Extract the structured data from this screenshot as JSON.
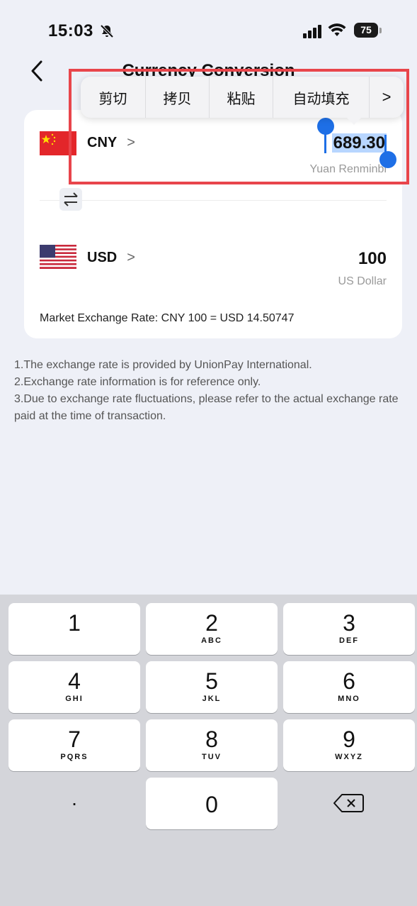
{
  "status_bar": {
    "time": "15:03",
    "battery": "75",
    "icons": [
      "bell-slash-icon",
      "signal-icon",
      "wifi-icon",
      "battery-icon"
    ]
  },
  "nav": {
    "title": "Currency Conversion",
    "back_icon": "chevron-left-icon"
  },
  "context_menu": {
    "items": [
      "剪切",
      "拷贝",
      "粘贴",
      "自动填充",
      ">"
    ]
  },
  "converter": {
    "from": {
      "code": "CNY",
      "chevron": ">",
      "amount": "689.30",
      "name": "Yuan Renminbi",
      "flag_icon": "china-flag-icon"
    },
    "to": {
      "code": "USD",
      "chevron": ">",
      "amount": "100",
      "name": "US Dollar",
      "flag_icon": "usa-flag-icon"
    },
    "swap_icon": "swap-arrows-icon",
    "rate_text": "Market Exchange Rate:  CNY 100 = USD 14.50747"
  },
  "notes": [
    "1.The exchange rate is provided by UnionPay International.",
    "2.Exchange rate information is for reference only.",
    "3.Due to exchange rate fluctuations, please refer to the actual exchange rate paid at the time of transaction."
  ],
  "keypad": {
    "keys": [
      {
        "num": "1",
        "letters": ""
      },
      {
        "num": "2",
        "letters": "ABC"
      },
      {
        "num": "3",
        "letters": "DEF"
      },
      {
        "num": "4",
        "letters": "GHI"
      },
      {
        "num": "5",
        "letters": "JKL"
      },
      {
        "num": "6",
        "letters": "MNO"
      },
      {
        "num": "7",
        "letters": "PQRS"
      },
      {
        "num": "8",
        "letters": "TUV"
      },
      {
        "num": "9",
        "letters": "WXYZ"
      }
    ],
    "decimal": ".",
    "zero": "0",
    "delete_icon": "backspace-icon"
  },
  "colors": {
    "accent": "#1e6fe6",
    "highlight_box": "#e8454b",
    "selection": "#b8d6ff"
  }
}
